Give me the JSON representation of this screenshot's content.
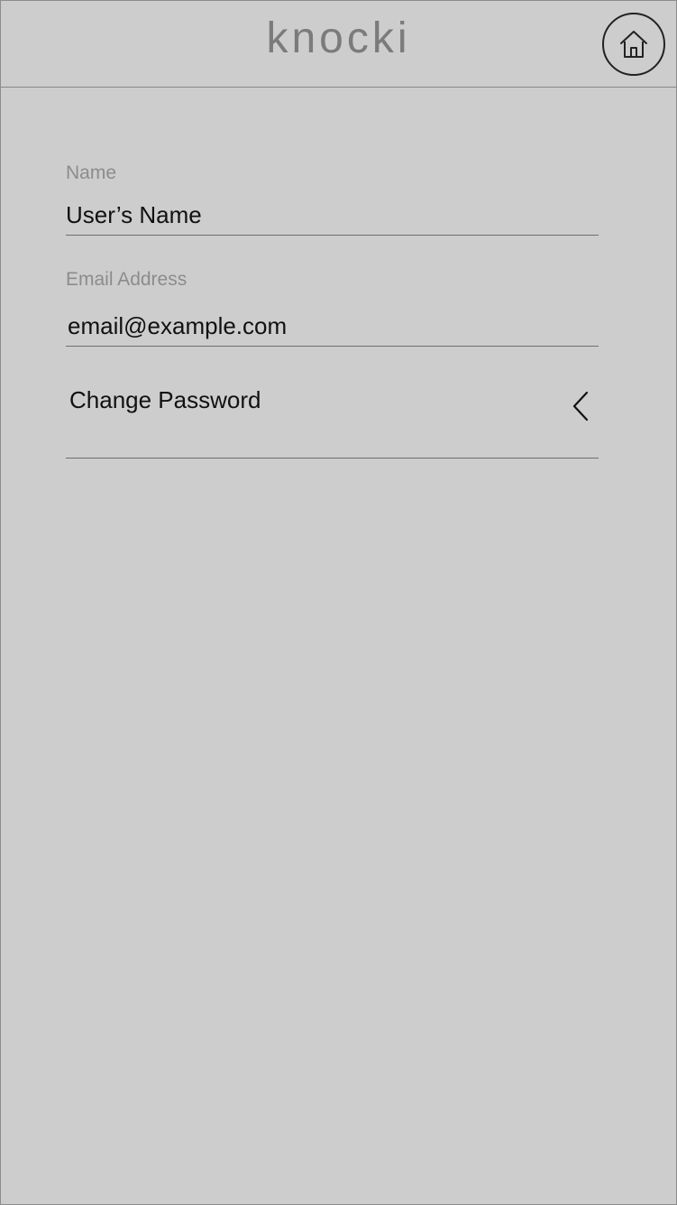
{
  "header": {
    "brand": "knocki",
    "home_icon": "home-icon"
  },
  "form": {
    "name": {
      "label": "Name",
      "value": "User’s Name"
    },
    "email": {
      "label": "Email Address",
      "value": "email@example.com"
    },
    "password": {
      "label": "Change Password",
      "icon": "chevron-left-icon"
    }
  },
  "colors": {
    "background": "#cdcdcd",
    "text_dark": "#111111",
    "text_muted": "#8c8c8c",
    "divider": "#6e6e6e"
  }
}
